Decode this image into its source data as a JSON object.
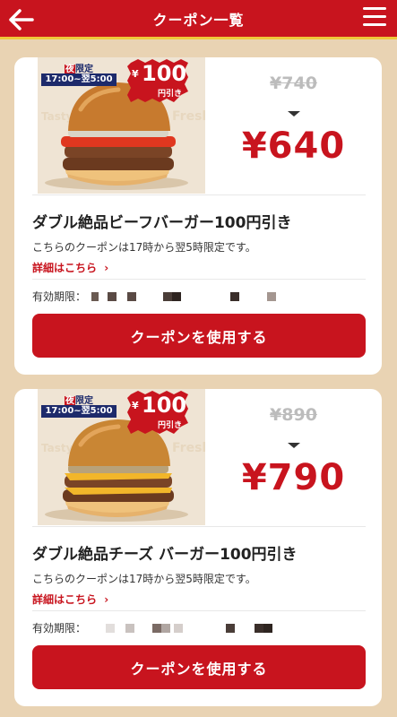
{
  "header": {
    "title": "クーポン一覧",
    "back_icon": "arrow-left-icon",
    "menu_icon": "hamburger-menu-icon"
  },
  "colors": {
    "brand_red": "#c8141e",
    "accent_yellow": "#f0c73a",
    "background": "#e9d3b3"
  },
  "coupons": [
    {
      "badge_night": "夜",
      "badge_limited": "限定",
      "badge_hours": "17:00~翌5:00",
      "badge_discount": "100",
      "badge_yen": "¥",
      "badge_off": "円引き",
      "old_price": "¥740",
      "new_price": "¥640",
      "name": "ダブル絶品ビーフバーガー100円引き",
      "description": "こちらのクーポンは17時から翌5時限定です。",
      "detail_link": "詳細はこちら",
      "validity_label": "有効期限：",
      "use_button": "クーポンを使用する"
    },
    {
      "badge_night": "夜",
      "badge_limited": "限定",
      "badge_hours": "17:00~翌5:00",
      "badge_discount": "100",
      "badge_yen": "¥",
      "badge_off": "円引き",
      "old_price": "¥890",
      "new_price": "¥790",
      "name": "ダブル絶品チーズ バーガー100円引き",
      "description": "こちらのクーポンは17時から翌5時限定です。",
      "detail_link": "詳細はこちら",
      "validity_label": "有効期限：",
      "use_button": "クーポンを使用する"
    }
  ]
}
